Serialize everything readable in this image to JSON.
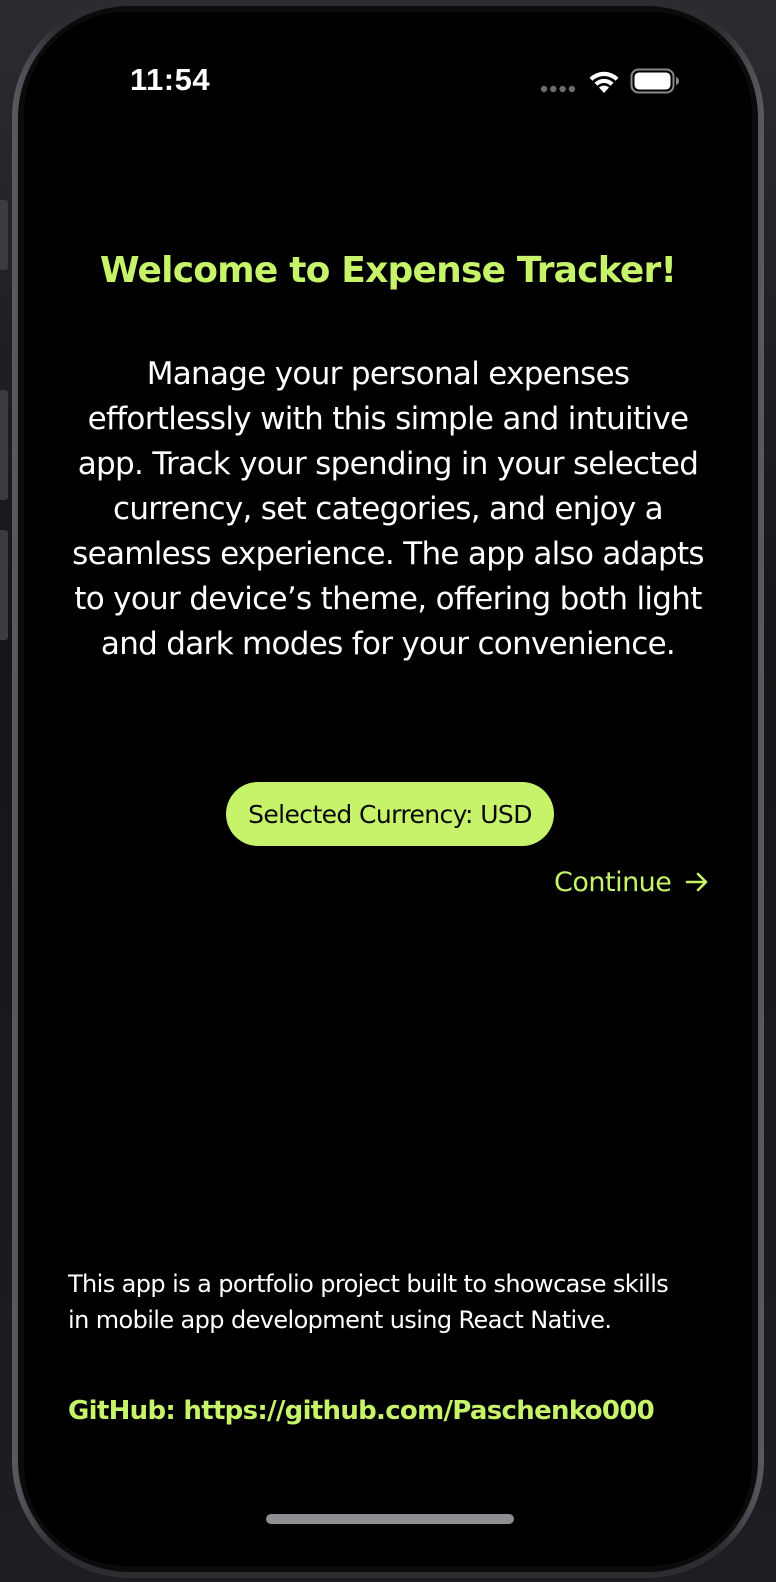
{
  "status_bar": {
    "time": "11:54"
  },
  "welcome": {
    "title": "Welcome to Expense Tracker!",
    "description": "Manage your personal expenses effortlessly with this simple and intuitive app. Track your spending in your selected currency, set categories, and enjoy a seamless experience. The app also adapts to your device’s theme, offering both light and dark modes for your convenience."
  },
  "currency": {
    "button_label": "Selected Currency: USD"
  },
  "actions": {
    "continue_label": "Continue"
  },
  "footer": {
    "text": "This app is a portfolio project built to showcase skills in mobile app development using React Native.",
    "github": "GitHub: https://github.com/Paschenko000"
  },
  "icons": {
    "signal": "cellular-dots-icon",
    "wifi": "wifi-icon",
    "battery": "battery-icon",
    "continue": "arrow-right-icon"
  },
  "colors": {
    "accent": "#c6f36a",
    "background": "#000000",
    "text": "#ffffff"
  }
}
